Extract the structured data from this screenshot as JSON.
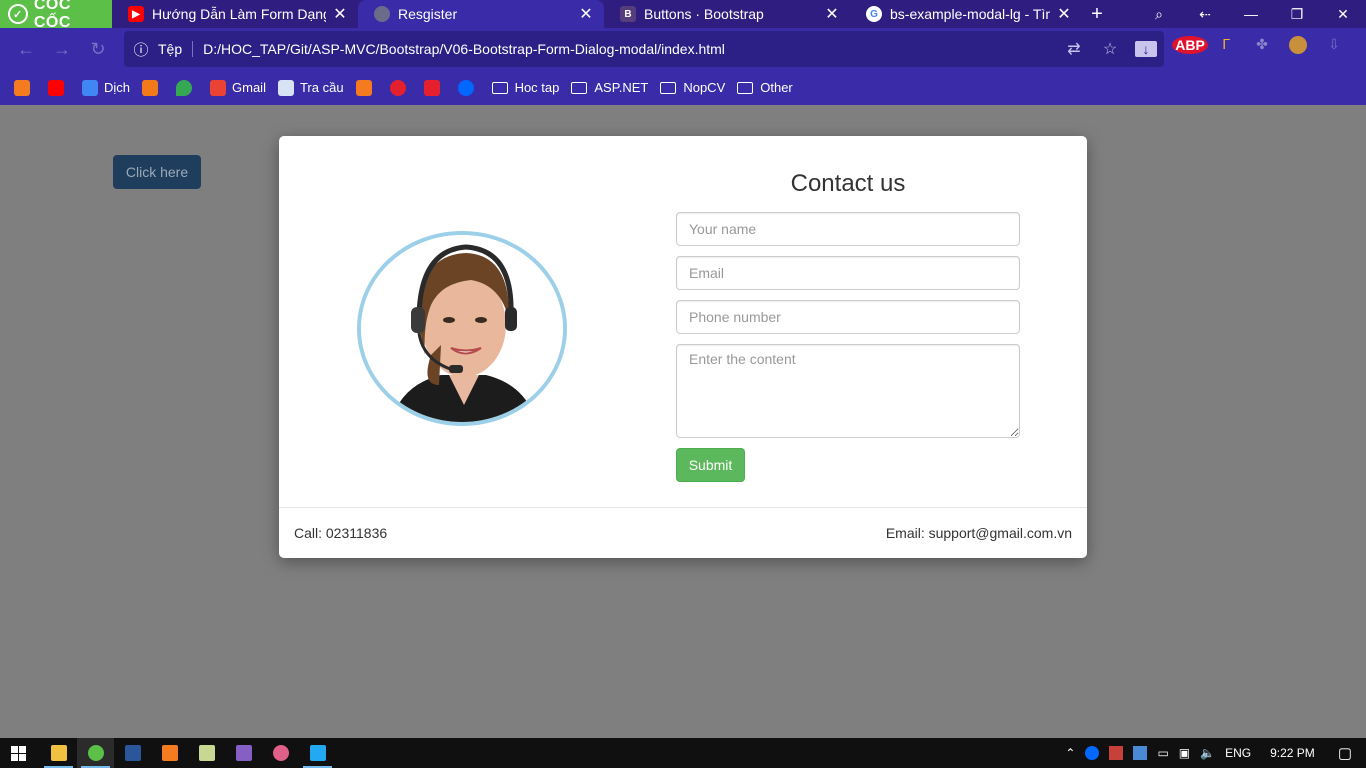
{
  "browser": {
    "brand": "CỐC CỐC",
    "tabs": [
      {
        "title": "Hướng Dẫn Làm Form Dạng",
        "icon": "youtube-icon",
        "color": "#ff0000"
      },
      {
        "title": "Resgister",
        "icon": "globe-icon",
        "color": "#6b6b8b"
      },
      {
        "title": "Buttons · Bootstrap",
        "icon": "bootstrap-icon",
        "color": "#563d7c"
      },
      {
        "title": "bs-example-modal-lg - Tìm t",
        "icon": "google-icon",
        "color": "#4285f4"
      }
    ],
    "address": {
      "security_label": "Tệp",
      "url": "D:/HOC_TAP/Git/ASP-MVC/Bootstrap/V06-Bootstrap-Form-Dialog-modal/index.html"
    },
    "bookmarks": [
      {
        "label": "",
        "icon": "coccoc-icon",
        "color": "#f47b20"
      },
      {
        "label": "",
        "icon": "youtube-icon",
        "color": "#ff0000"
      },
      {
        "label": "Dịch",
        "icon": "translate-icon",
        "color": "#4285f4"
      },
      {
        "label": "",
        "icon": "play-icon",
        "color": "#f27a1a"
      },
      {
        "label": "",
        "icon": "maps-icon",
        "color": "#34a853"
      },
      {
        "label": "Gmail",
        "icon": "gmail-icon",
        "color": "#ea4335"
      },
      {
        "label": "Tra cầu",
        "icon": "lookup-icon",
        "color": "#d7e3f4"
      },
      {
        "label": "",
        "icon": "search-orange-icon",
        "color": "#f47b20"
      },
      {
        "label": "",
        "icon": "record-icon",
        "color": "#e4202e"
      },
      {
        "label": "",
        "icon": "plus-red-icon",
        "color": "#e4202e"
      },
      {
        "label": "",
        "icon": "zalo-icon",
        "color": "#0068ff"
      }
    ],
    "folders": [
      "Hoc tap",
      "ASP.NET",
      "NopCV",
      "Other"
    ]
  },
  "page": {
    "open_button": "Click here",
    "modal": {
      "title": "Contact us",
      "name_placeholder": "Your name",
      "email_placeholder": "Email",
      "phone_placeholder": "Phone number",
      "content_placeholder": "Enter the content",
      "submit_label": "Submit",
      "footer_call": "Call: 02311836",
      "footer_email": "Email: support@gmail.com.vn"
    }
  },
  "taskbar": {
    "language": "ENG",
    "time": "9:22 PM"
  }
}
